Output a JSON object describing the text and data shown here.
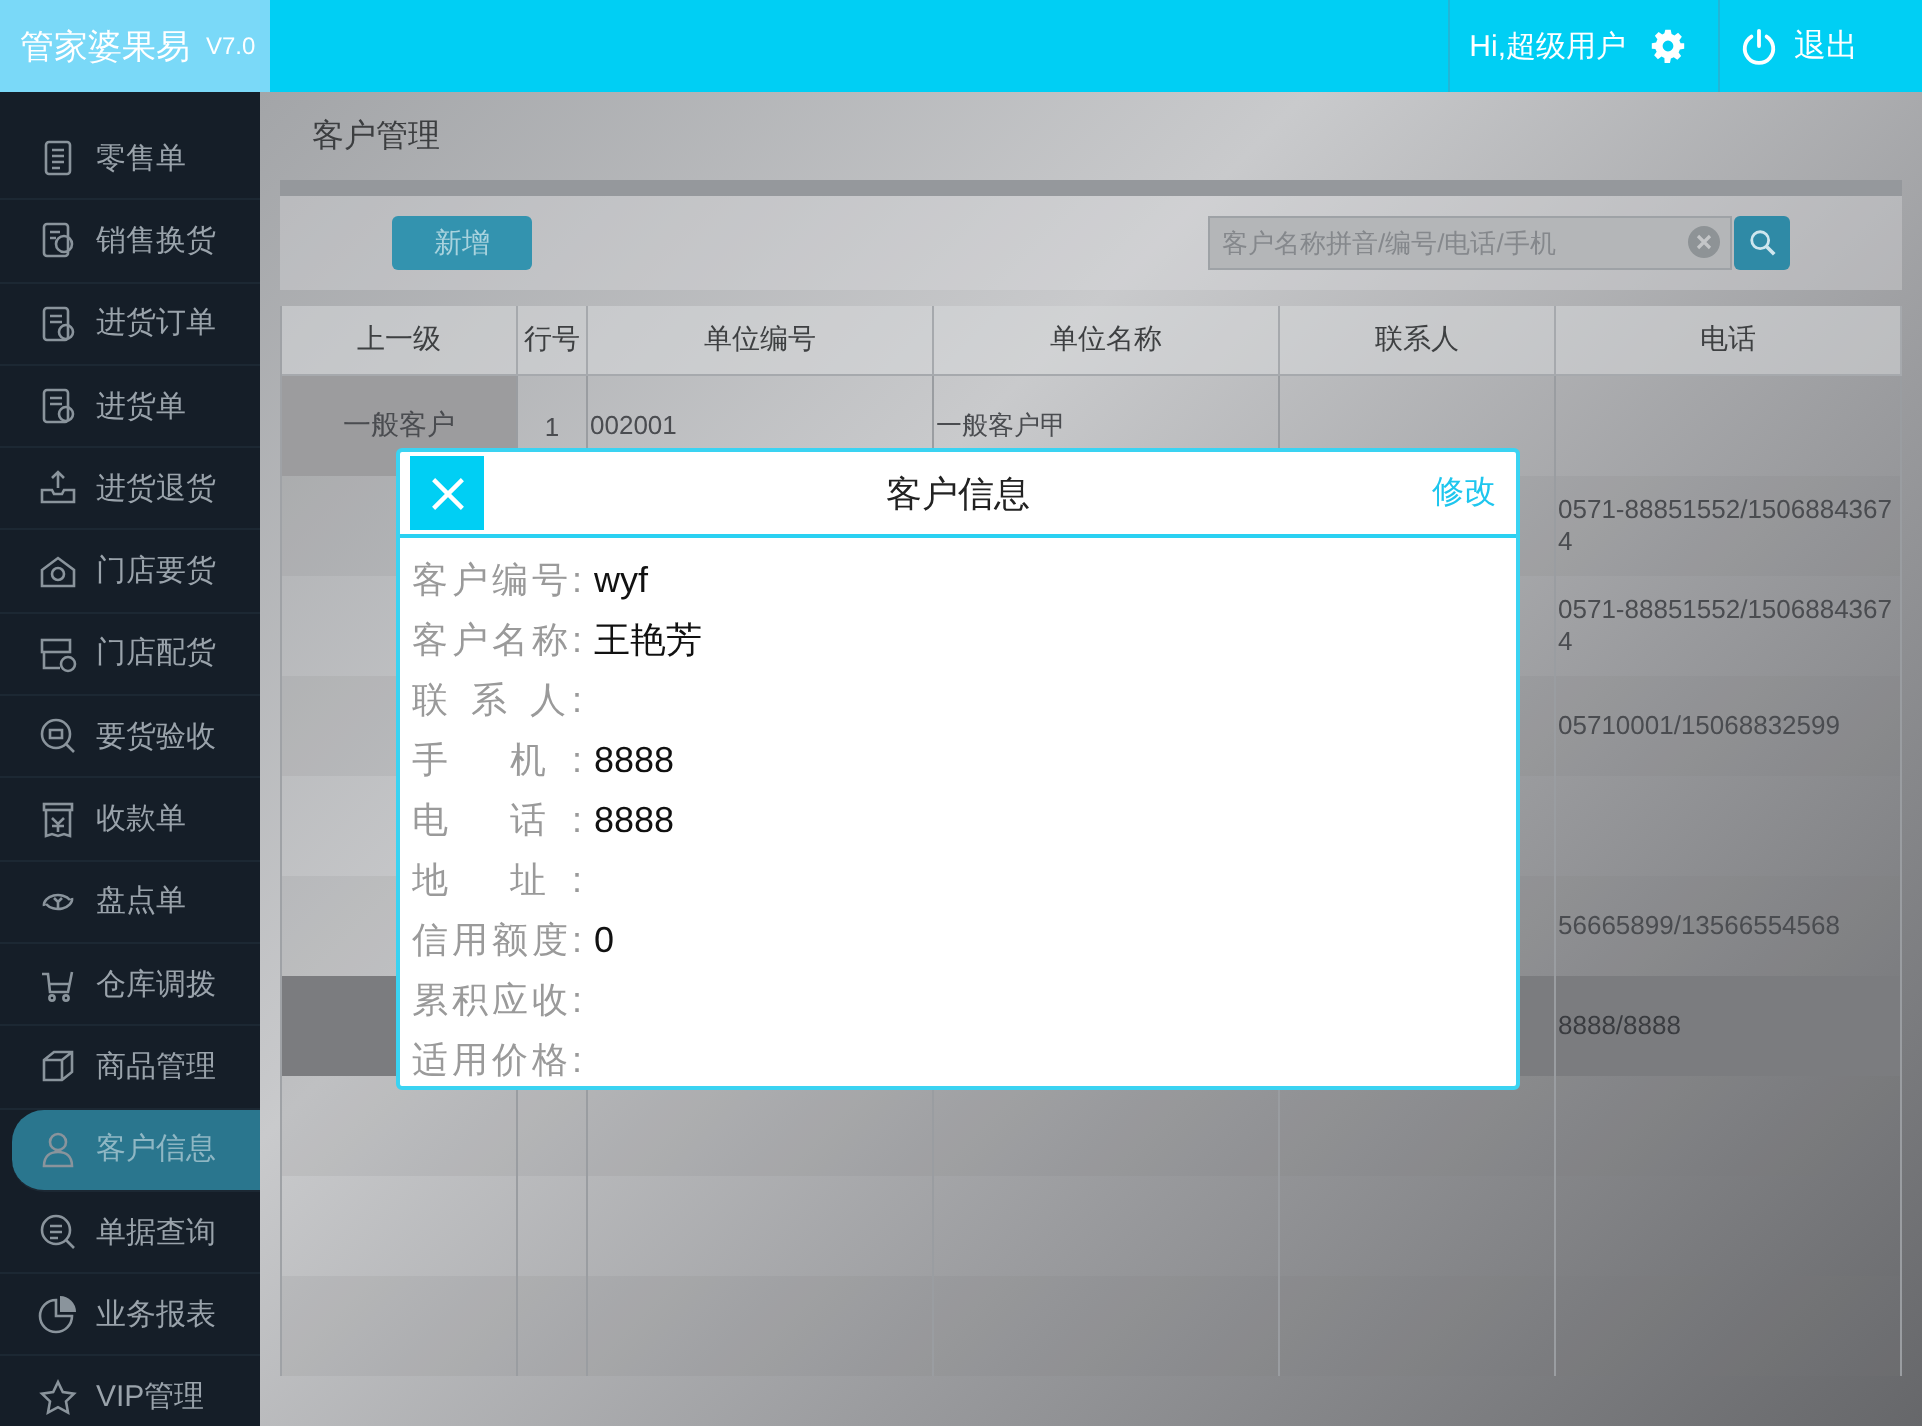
{
  "app": {
    "title": "管家婆果易",
    "version": "V7.0",
    "greeting": "Hi,超级用户",
    "logout": "退出"
  },
  "sidebar": {
    "items": [
      {
        "label": "零售单",
        "selected": false
      },
      {
        "label": "销售换货",
        "selected": false
      },
      {
        "label": "进货订单",
        "selected": false
      },
      {
        "label": "进货单",
        "selected": false
      },
      {
        "label": "进货退货",
        "selected": false
      },
      {
        "label": "门店要货",
        "selected": false
      },
      {
        "label": "门店配货",
        "selected": false
      },
      {
        "label": "要货验收",
        "selected": false
      },
      {
        "label": "收款单",
        "selected": false
      },
      {
        "label": "盘点单",
        "selected": false
      },
      {
        "label": "仓库调拨",
        "selected": false
      },
      {
        "label": "商品管理",
        "selected": false
      },
      {
        "label": "客户信息",
        "selected": true
      },
      {
        "label": "单据查询",
        "selected": false
      },
      {
        "label": "业务报表",
        "selected": false
      },
      {
        "label": "VIP管理",
        "selected": false
      }
    ]
  },
  "page_title": "客户管理",
  "toolbar": {
    "add_button": "新增",
    "search": {
      "placeholder": "客户名称拼音/编号/电话/手机"
    }
  },
  "table": {
    "columns": [
      "上一级",
      "行号",
      "单位编号",
      "单位名称",
      "联系人",
      "电话"
    ],
    "rows": [
      {
        "parent": "一般客户",
        "index": "1",
        "code": "002001",
        "name": "一般客户甲",
        "selected": false
      },
      {
        "phone": "0571-88851552/15068843674",
        "selected": false
      },
      {
        "phone": "0571-88851552/15068843674",
        "selected": false
      },
      {
        "phone": "05710001/15068832599",
        "selected": false
      },
      {
        "selected": false
      },
      {
        "phone": "56665899/13566554568",
        "selected": false
      },
      {
        "phone": "8888/8888",
        "selected": true
      }
    ]
  },
  "dialog": {
    "title": "客户信息",
    "edit_link": "修改",
    "fields": [
      {
        "label": "客户编号:",
        "value": "wyf"
      },
      {
        "label": "客户名称:",
        "value": "王艳芳"
      },
      {
        "label": "联 系 人:"
      },
      {
        "label": "手 机:",
        "value": "8888"
      },
      {
        "label": "电 话:",
        "value": "8888"
      },
      {
        "label": "地 址:"
      },
      {
        "label": "信用额度:",
        "value": "0"
      },
      {
        "label": "累积应收:"
      },
      {
        "label": "适用价格:"
      }
    ]
  }
}
